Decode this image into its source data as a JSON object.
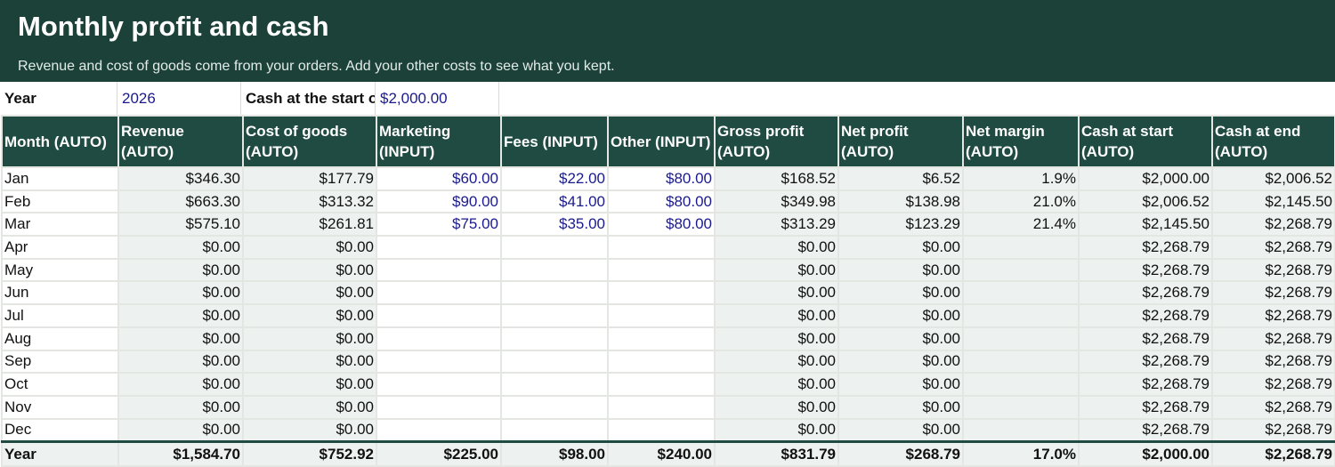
{
  "banner": {
    "title": "Monthly profit and cash",
    "subtitle": "Revenue and cost of goods come from your orders. Add your other costs to see what you kept."
  },
  "settings": {
    "year_label": "Year",
    "year_value": "2026",
    "cash_label": "Cash at the start of the year",
    "cash_value": "$2,000.00"
  },
  "columns": [
    {
      "label": "Month (AUTO)",
      "kind": "month"
    },
    {
      "label": "Revenue (AUTO)",
      "kind": "auto"
    },
    {
      "label": "Cost of goods (AUTO)",
      "kind": "auto"
    },
    {
      "label": "Marketing (INPUT)",
      "kind": "input"
    },
    {
      "label": "Fees (INPUT)",
      "kind": "input"
    },
    {
      "label": "Other (INPUT)",
      "kind": "input"
    },
    {
      "label": "Gross profit (AUTO)",
      "kind": "auto"
    },
    {
      "label": "Net profit (AUTO)",
      "kind": "auto"
    },
    {
      "label": "Net margin (AUTO)",
      "kind": "auto"
    },
    {
      "label": "Cash at start (AUTO)",
      "kind": "auto"
    },
    {
      "label": "Cash at end (AUTO)",
      "kind": "auto"
    }
  ],
  "rows": [
    [
      "Jan",
      "$346.30",
      "$177.79",
      "$60.00",
      "$22.00",
      "$80.00",
      "$168.52",
      "$6.52",
      "1.9%",
      "$2,000.00",
      "$2,006.52"
    ],
    [
      "Feb",
      "$663.30",
      "$313.32",
      "$90.00",
      "$41.00",
      "$80.00",
      "$349.98",
      "$138.98",
      "21.0%",
      "$2,006.52",
      "$2,145.50"
    ],
    [
      "Mar",
      "$575.10",
      "$261.81",
      "$75.00",
      "$35.00",
      "$80.00",
      "$313.29",
      "$123.29",
      "21.4%",
      "$2,145.50",
      "$2,268.79"
    ],
    [
      "Apr",
      "$0.00",
      "$0.00",
      "",
      "",
      "",
      "$0.00",
      "$0.00",
      "",
      "$2,268.79",
      "$2,268.79"
    ],
    [
      "May",
      "$0.00",
      "$0.00",
      "",
      "",
      "",
      "$0.00",
      "$0.00",
      "",
      "$2,268.79",
      "$2,268.79"
    ],
    [
      "Jun",
      "$0.00",
      "$0.00",
      "",
      "",
      "",
      "$0.00",
      "$0.00",
      "",
      "$2,268.79",
      "$2,268.79"
    ],
    [
      "Jul",
      "$0.00",
      "$0.00",
      "",
      "",
      "",
      "$0.00",
      "$0.00",
      "",
      "$2,268.79",
      "$2,268.79"
    ],
    [
      "Aug",
      "$0.00",
      "$0.00",
      "",
      "",
      "",
      "$0.00",
      "$0.00",
      "",
      "$2,268.79",
      "$2,268.79"
    ],
    [
      "Sep",
      "$0.00",
      "$0.00",
      "",
      "",
      "",
      "$0.00",
      "$0.00",
      "",
      "$2,268.79",
      "$2,268.79"
    ],
    [
      "Oct",
      "$0.00",
      "$0.00",
      "",
      "",
      "",
      "$0.00",
      "$0.00",
      "",
      "$2,268.79",
      "$2,268.79"
    ],
    [
      "Nov",
      "$0.00",
      "$0.00",
      "",
      "",
      "",
      "$0.00",
      "$0.00",
      "",
      "$2,268.79",
      "$2,268.79"
    ],
    [
      "Dec",
      "$0.00",
      "$0.00",
      "",
      "",
      "",
      "$0.00",
      "$0.00",
      "",
      "$2,268.79",
      "$2,268.79"
    ]
  ],
  "totals": [
    "Year",
    "$1,584.70",
    "$752.92",
    "$225.00",
    "$98.00",
    "$240.00",
    "$831.79",
    "$268.79",
    "17.0%",
    "$2,000.00",
    "$2,268.79"
  ],
  "colors": {
    "banner": "#1b4139",
    "header": "#1f4b42",
    "auto_cell": "#edf2f0",
    "input_text": "#1a1a8c"
  }
}
